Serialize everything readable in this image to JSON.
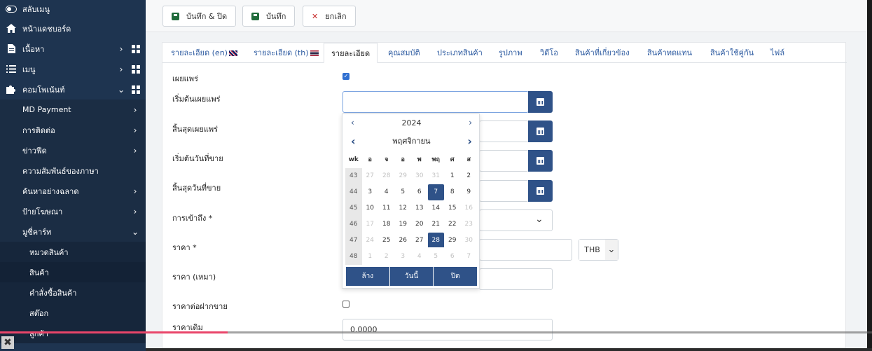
{
  "sidebar": {
    "toggle_label": "สลับเมนู",
    "items": [
      {
        "label": "หน้าแดชบอร์ด",
        "icon": "home-icon"
      },
      {
        "label": "เนื้อหา",
        "icon": "file-icon"
      },
      {
        "label": "เมนู",
        "icon": "list-icon"
      },
      {
        "label": "คอมโพเน้นท์",
        "icon": "puzzle-icon"
      }
    ],
    "components": [
      "MD Payment",
      "การติดต่อ",
      "ข่าวฟีด",
      "ความสัมพันธ์ของภาษา",
      "ค้นหาอย่างฉลาด",
      "ป้ายโฆษณา",
      "มูซี่คาร์ท"
    ],
    "cart_items": [
      "หมวดสินค้า",
      "สินค้า",
      "คำสั่งซื้อสินค้า",
      "สต๊อก",
      "ลูกค้า"
    ]
  },
  "toolbar": {
    "save_close": "บันทึก & ปิด",
    "save": "บันทึก",
    "cancel": "ยกเลิก"
  },
  "tabs": [
    "รายละเอียด (en)",
    "รายละเอียด (th)",
    "รายละเอียด",
    "คุณสมบัติ",
    "ประเภทสินค้า",
    "รูปภาพ",
    "วิดีโอ",
    "สินค้าที่เกี่ยวข้อง",
    "สินค้าทดแทน",
    "สินค้าใช้คู่กัน",
    "ไฟล์"
  ],
  "form": {
    "published": "เผยแพร่",
    "publish_start": "เริ่มต้นเผยแพร่",
    "publish_end": "สิ้นสุดเผยแพร่",
    "sale_start": "เริ่มต้นวันที่ขาย",
    "sale_end": "สิ้นสุดวันที่ขาย",
    "access": "การเข้าถึง *",
    "price": "ราคา *",
    "currency": "THB",
    "price_bulk": "ราคา (เหมา)",
    "consign_price": "ราคาต่อฝากขาย",
    "original_price": "ราคาเดิม",
    "original_price_value": "0.0000"
  },
  "calendar": {
    "year": "2024",
    "month": "พฤศจิกายน",
    "headers": [
      "wk",
      "อ",
      "จ",
      "อ",
      "พ",
      "พฤ",
      "ศ",
      "ส"
    ],
    "weeks": [
      [
        "43",
        "27",
        "28",
        "29",
        "30",
        "31",
        "1",
        "2"
      ],
      [
        "44",
        "3",
        "4",
        "5",
        "6",
        "7",
        "8",
        "9"
      ],
      [
        "45",
        "10",
        "11",
        "12",
        "13",
        "14",
        "15",
        "16"
      ],
      [
        "46",
        "17",
        "18",
        "19",
        "20",
        "21",
        "22",
        "23"
      ],
      [
        "47",
        "24",
        "25",
        "26",
        "27",
        "28",
        "29",
        "30"
      ],
      [
        "48",
        "1",
        "2",
        "3",
        "4",
        "5",
        "6",
        "7"
      ]
    ],
    "clear": "ล้าง",
    "today": "วันนี้",
    "close": "ปิด"
  },
  "colors": {
    "sidebar_bg": "#1e3450",
    "accent": "#2f5288",
    "link": "#2c5aa0"
  }
}
